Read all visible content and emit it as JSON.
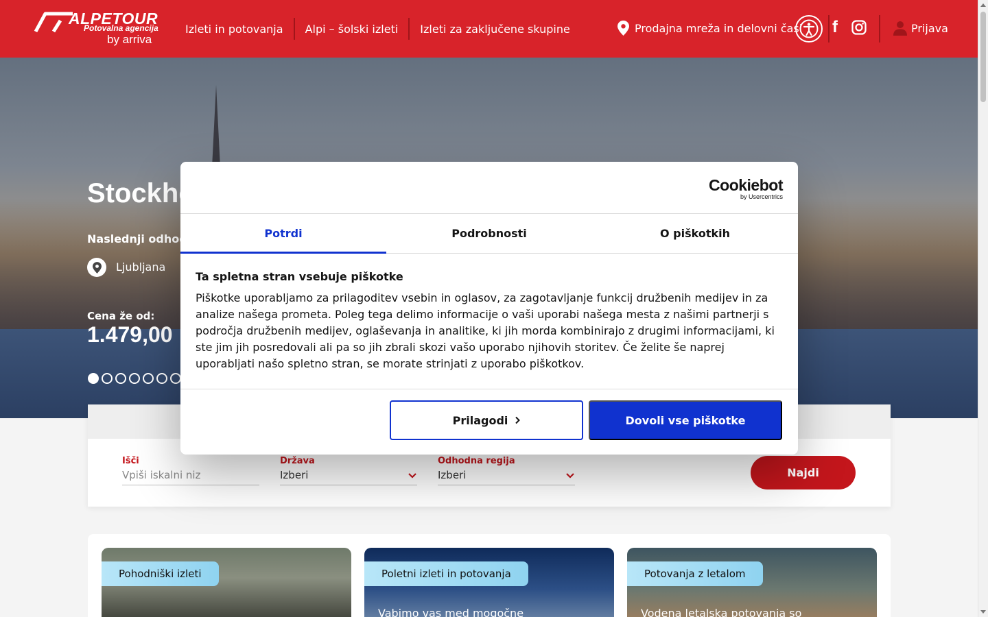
{
  "header": {
    "brand": "ALPETOUR",
    "tagline": "Potovalna agencija",
    "by": "by arriva",
    "nav": [
      {
        "label": "Izleti in potovanja"
      },
      {
        "label": "Alpi – šolski izleti"
      },
      {
        "label": "Izleti za zaključene skupine"
      }
    ],
    "store_link": "Prodajna mreža in delovni časi",
    "facebook": "f",
    "login": "Prijava"
  },
  "hero": {
    "title": "Stockho",
    "next_departure_label": "Naslednji odhod",
    "city": "Ljubljana",
    "price_label": "Cena že od:",
    "price": "1.479,00 ",
    "slides_total": 7,
    "active_slide": 1
  },
  "search": {
    "query": {
      "label": "Išči",
      "placeholder": "Vpiši iskalni niz"
    },
    "country": {
      "label": "Država",
      "value": "Izberi"
    },
    "region": {
      "label": "Odhodna regija",
      "value": "Izberi"
    },
    "submit": "Najdi"
  },
  "cards": [
    {
      "tag": "Pohodniški izleti",
      "teaser": ""
    },
    {
      "tag": "Poletni izleti in potovanja",
      "teaser": "Vabimo vas med mogočne"
    },
    {
      "tag": "Potovanja z letalom",
      "teaser": "Vodena letalska potovanja so"
    }
  ],
  "cookie_dialog": {
    "logo": "Cookiebot",
    "logo_sub": "by Usercentrics",
    "tabs": [
      {
        "label": "Potrdi",
        "active": true
      },
      {
        "label": "Podrobnosti",
        "active": false
      },
      {
        "label": "O piškotkih",
        "active": false
      }
    ],
    "title": "Ta spletna stran vsebuje piškotke",
    "text": "Piškotke uporabljamo za prilagoditev vsebin in oglasov, za zagotavljanje funkcij družbenih medijev in za analize našega prometa. Poleg tega delimo informacije o vaši uporabi našega mesta z našimi partnerji s področja družbenih medijev, oglaševanja in analitike, ki jih morda kombinirajo z drugimi informacijami, ki ste jim jih posredovali ali pa so jih zbrali skozi vašo uporabo njihovih storitev. Če želite še naprej uporabljati našo spletno stran, se morate strinjati z uporabo piškotkov.",
    "customize": "Prilagodi",
    "allow_all": "Dovoli vse piškotke"
  },
  "colors": {
    "brand_red": "#d8232a",
    "accent_red": "#c4161c",
    "cookie_blue": "#1032cf",
    "tag_blue": "#8fd3f0"
  }
}
